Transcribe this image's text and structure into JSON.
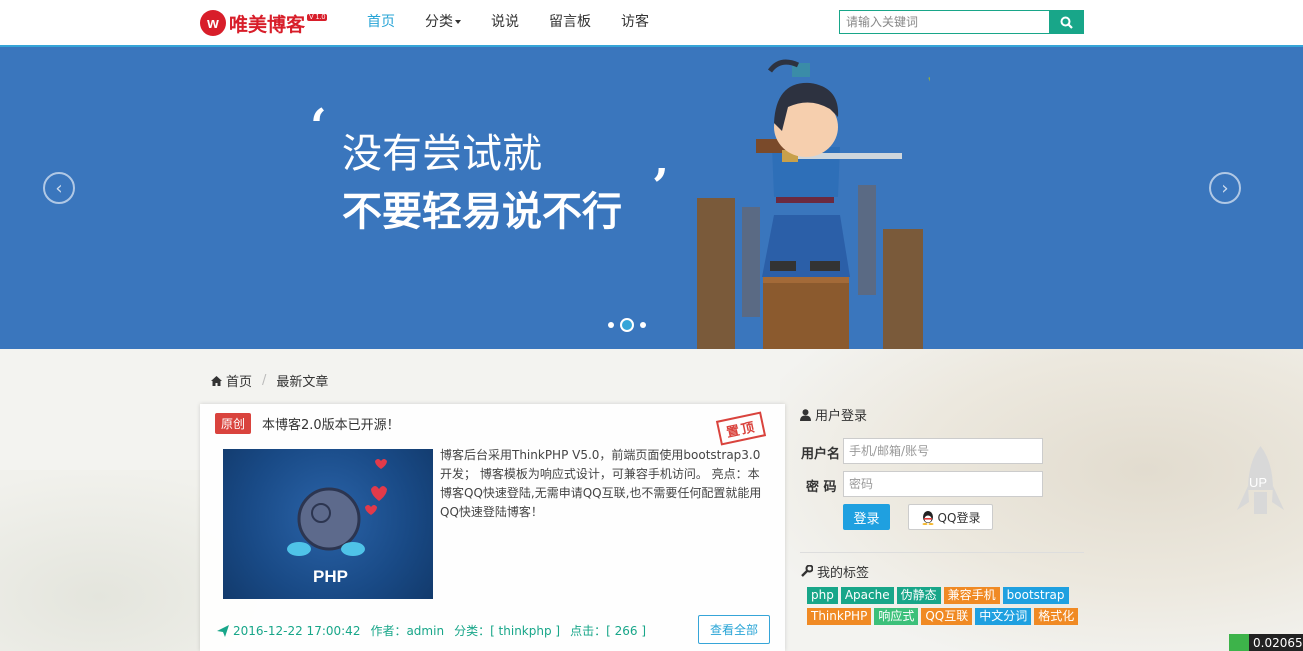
{
  "header": {
    "logo_letter": "w",
    "logo_text": "唯美博客",
    "logo_version": "V 1.0",
    "nav": [
      {
        "label": "首页",
        "active": true
      },
      {
        "label": "分类",
        "dropdown": true
      },
      {
        "label": "说说"
      },
      {
        "label": "留言板"
      },
      {
        "label": "访客"
      }
    ],
    "search_placeholder": "请输入关键词",
    "search_icon": "search-icon"
  },
  "banner": {
    "line1": "没有尝试就",
    "line2": "不要轻易说不行",
    "quote_open": "‘",
    "quote_close": "’",
    "prev_arrow": "‹",
    "next_arrow": "›",
    "slides": 3,
    "active_slide": 2
  },
  "breadcrumb": {
    "home": "首页",
    "current": "最新文章"
  },
  "article": {
    "badge": "原创",
    "title": "本博客2.0版本已开源！",
    "stamp": "置顶",
    "thumb_label": "PHP",
    "description": "博客后台采用ThinkPHP V5.0，前端页面使用bootstrap3.0开发； 博客模板为响应式设计，可兼容手机访问。 亮点：本博客QQ快速登陆,无需申请QQ互联,也不需要任何配置就能用QQ快速登陆博客！",
    "date": "2016-12-22 17:00:42",
    "author": "作者：admin",
    "category": "分类：[ thinkphp ]",
    "clicks": "点击：[ 266 ]",
    "view_all": "查看全部"
  },
  "login": {
    "title": "用户登录",
    "username_label": "用户名",
    "username_placeholder": "手机/邮箱/账号",
    "password_label": "密 码",
    "password_placeholder": "密码",
    "login_button": "登录",
    "qq_button": "QQ登录"
  },
  "tags": {
    "title": "我的标签",
    "items": [
      {
        "label": "php",
        "color": "#18a689"
      },
      {
        "label": "Apache",
        "color": "#18a689"
      },
      {
        "label": "伪静态",
        "color": "#18a689"
      },
      {
        "label": "兼容手机",
        "color": "#f08a24"
      },
      {
        "label": "bootstrap",
        "color": "#1fa0e0"
      },
      {
        "label": "ThinkPHP",
        "color": "#f08a24"
      },
      {
        "label": "响应式",
        "color": "#3cc07a"
      },
      {
        "label": "QQ互联",
        "color": "#f08a24"
      },
      {
        "label": "中文分词",
        "color": "#1fa0e0"
      },
      {
        "label": "格式化",
        "color": "#f08a24"
      }
    ]
  },
  "up_button": "UP",
  "timer": "0.020652"
}
